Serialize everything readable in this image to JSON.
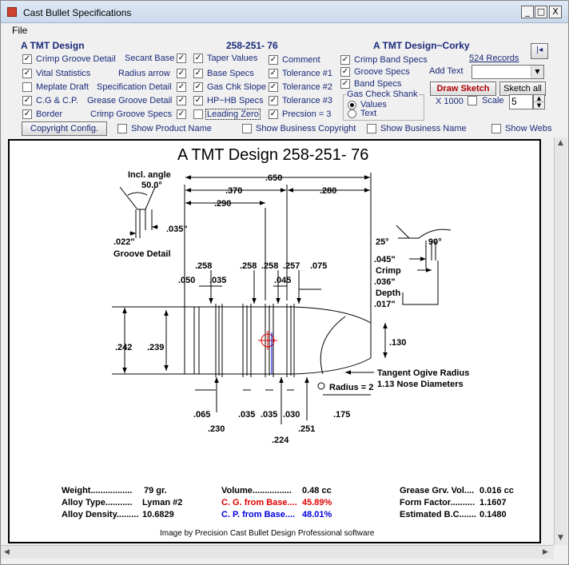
{
  "window": {
    "title": "Cast Bullet Specifications",
    "minimize": "_",
    "maximize": "□",
    "close": "X"
  },
  "menu": {
    "file": "File"
  },
  "header": {
    "left": "A TMT Design",
    "center": "258-251- 76",
    "right": "A TMT Design~Corky"
  },
  "options": {
    "crimp_groove_detail": "Crimp Groove Detail",
    "vital_statistics": "Vital Statistics",
    "meplate_draft": "Meplate Draft",
    "cg_cp": "C.G & C.P.",
    "border": "Border",
    "secant_base": "Secant Base",
    "radius_arrow": "Radius arrow",
    "specification_detail": "Specification Detail",
    "grease_groove_detail": "Grease Groove Detail",
    "crimp_groove_specs": "Crimp Groove Specs",
    "taper_values": "Taper Values",
    "base_specs": "Base Specs",
    "gas_chk_slope": "Gas Chk Slope",
    "hp_hb_specs": "HP~HB Specs",
    "leading_zero": "Leading Zero",
    "comment": "Comment",
    "tolerance1": "Tolerance #1",
    "tolerance2": "Tolerance #2",
    "tolerance3": "Tolerance #3",
    "precision": "Precsion = 3",
    "crimp_band_specs": "Crimp Band Specs",
    "groove_specs": "Groove Specs",
    "band_specs": "Band Specs"
  },
  "gas_check": {
    "title": "Gas Check Shank",
    "values": "Values",
    "text": "Text"
  },
  "records": "524 Records",
  "add_text_label": "Add Text",
  "draw_sketch": "Draw  Sketch",
  "sketch_all": "Sketch all",
  "x1000": "X 1000",
  "scale_label": "Scale",
  "scale_value": "5",
  "copyright_config": "Copyright Config.",
  "show": {
    "product_name": "Show Product Name",
    "business_copyright": "Show Business Copyright",
    "business_name": "Show Business Name",
    "website": "Show Webs"
  },
  "drawing": {
    "title": "A TMT Design   258-251- 76",
    "incl_angle_label": "Incl. angle",
    "incl_angle_value": "50.0°",
    "groove_022": ".022\"",
    "groove_035": ".035\"",
    "groove_detail": "Groove Detail",
    "len_650": ".650",
    "len_370": ".370",
    "len_280": ".280",
    "len_290": ".290",
    "angle_25": "25°",
    "angle_90": "90°",
    "crimp_045": ".045\"",
    "crimp_label": "Crimp",
    "crimp_036": ".036\"",
    "depth_label": "Depth",
    "crimp_017": ".017\"",
    "d_258a": ".258",
    "d_258b": ".258",
    "d_258c": ".258",
    "d_257": ".257",
    "d_075": ".075",
    "d_050": ".050",
    "d_035": ".035",
    "d_045": ".045",
    "d_242": ".242",
    "d_239": ".239",
    "d_130": ".130",
    "tangent_ogive": "Tangent Ogive Radius",
    "radius_label": "Radius = 2",
    "nose_diam": "1.13  Nose Diameters",
    "b_065": ".065",
    "b_035a": ".035",
    "b_035b": ".035",
    "b_030": ".030",
    "b_175": ".175",
    "b_230": ".230",
    "b_251": ".251",
    "b_224": ".224",
    "stats": {
      "weight_label": "Weight.................",
      "weight_value": "79 gr.",
      "alloy_label": "Alloy Type...........",
      "alloy_value": "Lyman #2",
      "density_label": "Alloy Density.........",
      "density_value": "10.6829",
      "volume_label": "Volume................",
      "volume_value": "0.48 cc",
      "cg_label": "C. G. from Base....",
      "cg_value": "45.89%",
      "cp_label": "C. P. from Base....",
      "cp_value": "48.01%",
      "grease_label": "Grease Grv. Vol....",
      "grease_value": "0.016 cc",
      "form_label": "Form Factor..........",
      "form_value": "1.1607",
      "bc_label": "Estimated B.C.......",
      "bc_value": "0.1480"
    },
    "credit": "Image by Precision Cast Bullet Design Professional software"
  },
  "colors": {
    "label_blue": "#1a2a7a",
    "cg_red": "#e00000",
    "cp_blue": "#0000dd",
    "draw_red": "#b00000"
  }
}
